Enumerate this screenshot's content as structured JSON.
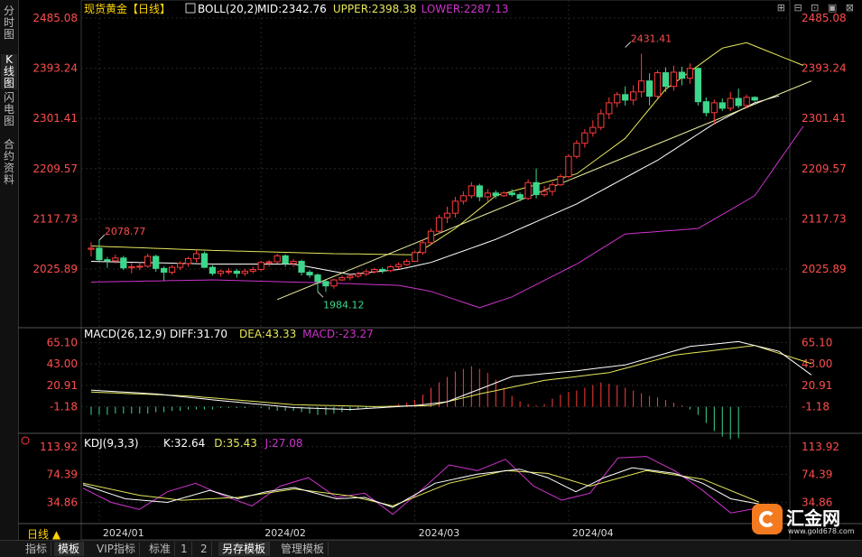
{
  "side_tabs": [
    "分时图",
    "K线图",
    "闪电图",
    "合约资料"
  ],
  "side_tab_active": 1,
  "toolbar_glyphs": "⊞ ⊟ ⊡ ▣ ⊠",
  "period_label": "日线 ▲",
  "bottom_tabs": [
    "指标",
    "模板",
    "VIP指标",
    "标准",
    "1",
    "2",
    "另存模板",
    "管理模板"
  ],
  "bottom_tab_active": [
    1,
    6
  ],
  "watermark": {
    "text": "汇金网",
    "url": "www.gold678.com"
  },
  "colors": {
    "up": "#ff3b3b",
    "down": "#3dd68c",
    "mid": "#ffffff",
    "upper": "#e6e65c",
    "lower": "#cc33cc",
    "trend": "#f0f0a0",
    "axis_red": "#ff4d4d",
    "macd_diff": "#ffffff",
    "macd_dea": "#e6e65c",
    "kdj_k": "#ffffff",
    "kdj_d": "#e6e65c",
    "kdj_j": "#cc33cc"
  },
  "chart_data": [
    {
      "type": "candlestick",
      "title": "现货黄金【日线】",
      "indicator": "BOLL(20,2)",
      "legend": [
        {
          "label": "MID:2342.76",
          "color": "mid"
        },
        {
          "label": "UPPER:2398.38",
          "color": "upper"
        },
        {
          "label": "LOWER:2287.13",
          "color": "lower"
        }
      ],
      "y_ticks": [
        "2485.08",
        "2393.24",
        "2301.41",
        "2209.57",
        "2117.73",
        "2025.89"
      ],
      "ylim": [
        1940,
        2485.08
      ],
      "x_ticks": [
        "2024/01",
        "2024/02",
        "2024/03",
        "2024/04"
      ],
      "x_tick_index": [
        1,
        21,
        40,
        59
      ],
      "annotations": [
        {
          "text": "2078.77",
          "index": 1,
          "value": 2078.77,
          "color": "#ff4d4d"
        },
        {
          "text": "1984.12",
          "index": 28,
          "value": 1984.12,
          "color": "#3dd68c"
        },
        {
          "text": "2431.41",
          "index": 66,
          "value": 2431.41,
          "color": "#ff4d4d"
        }
      ],
      "candles": [
        [
          2062,
          2064,
          2049,
          2075
        ],
        [
          2064,
          2043,
          2040,
          2079
        ],
        [
          2043,
          2041,
          2028,
          2048
        ],
        [
          2041,
          2046,
          2036,
          2052
        ],
        [
          2046,
          2028,
          2024,
          2050
        ],
        [
          2028,
          2030,
          2018,
          2037
        ],
        [
          2030,
          2031,
          2024,
          2038
        ],
        [
          2031,
          2049,
          2028,
          2054
        ],
        [
          2049,
          2027,
          2021,
          2052
        ],
        [
          2027,
          2020,
          2005,
          2031
        ],
        [
          2020,
          2029,
          2016,
          2033
        ],
        [
          2029,
          2036,
          2024,
          2040
        ],
        [
          2036,
          2045,
          2030,
          2048
        ],
        [
          2045,
          2054,
          2038,
          2060
        ],
        [
          2054,
          2029,
          2028,
          2058
        ],
        [
          2029,
          2018,
          2014,
          2033
        ],
        [
          2018,
          2022,
          2012,
          2025
        ],
        [
          2022,
          2022,
          2016,
          2028
        ],
        [
          2022,
          2018,
          2010,
          2026
        ],
        [
          2018,
          2022,
          2013,
          2026
        ],
        [
          2022,
          2025,
          2018,
          2030
        ],
        [
          2025,
          2038,
          2022,
          2041
        ],
        [
          2038,
          2039,
          2030,
          2042
        ],
        [
          2039,
          2050,
          2036,
          2054
        ],
        [
          2050,
          2036,
          2030,
          2053
        ],
        [
          2036,
          2040,
          2030,
          2044
        ],
        [
          2040,
          2020,
          2014,
          2043
        ],
        [
          2020,
          2015,
          2010,
          2024
        ],
        [
          2015,
          2003,
          1984,
          2018
        ],
        [
          2003,
          1995,
          1984,
          2006
        ],
        [
          1995,
          2006,
          1990,
          2008
        ],
        [
          2006,
          2010,
          2004,
          2014
        ],
        [
          2010,
          2013,
          2005,
          2016
        ],
        [
          2013,
          2017,
          2010,
          2021
        ],
        [
          2017,
          2021,
          2013,
          2025
        ],
        [
          2021,
          2025,
          2018,
          2028
        ],
        [
          2025,
          2023,
          2018,
          2029
        ],
        [
          2023,
          2030,
          2020,
          2033
        ],
        [
          2030,
          2034,
          2025,
          2038
        ],
        [
          2034,
          2040,
          2032,
          2044
        ],
        [
          2040,
          2056,
          2040,
          2060
        ],
        [
          2056,
          2074,
          2052,
          2080
        ],
        [
          2074,
          2095,
          2070,
          2100
        ],
        [
          2095,
          2120,
          2090,
          2125
        ],
        [
          2120,
          2128,
          2110,
          2140
        ],
        [
          2128,
          2150,
          2120,
          2158
        ],
        [
          2150,
          2160,
          2144,
          2168
        ],
        [
          2160,
          2178,
          2155,
          2185
        ],
        [
          2178,
          2158,
          2150,
          2182
        ],
        [
          2158,
          2165,
          2150,
          2172
        ],
        [
          2165,
          2160,
          2155,
          2170
        ],
        [
          2160,
          2165,
          2158,
          2168
        ],
        [
          2165,
          2162,
          2158,
          2172
        ],
        [
          2162,
          2155,
          2150,
          2166
        ],
        [
          2155,
          2184,
          2152,
          2190
        ],
        [
          2184,
          2162,
          2155,
          2210
        ],
        [
          2162,
          2168,
          2158,
          2178
        ],
        [
          2168,
          2180,
          2160,
          2185
        ],
        [
          2180,
          2195,
          2178,
          2200
        ],
        [
          2195,
          2232,
          2192,
          2236
        ],
        [
          2232,
          2256,
          2228,
          2262
        ],
        [
          2256,
          2275,
          2248,
          2282
        ],
        [
          2275,
          2285,
          2268,
          2298
        ],
        [
          2285,
          2310,
          2280,
          2318
        ],
        [
          2310,
          2330,
          2300,
          2340
        ],
        [
          2330,
          2345,
          2322,
          2350
        ],
        [
          2345,
          2335,
          2325,
          2360
        ],
        [
          2335,
          2350,
          2326,
          2362
        ],
        [
          2350,
          2370,
          2340,
          2420
        ],
        [
          2370,
          2342,
          2325,
          2384
        ],
        [
          2342,
          2385,
          2338,
          2390
        ],
        [
          2385,
          2360,
          2350,
          2395
        ],
        [
          2360,
          2386,
          2352,
          2398
        ],
        [
          2386,
          2375,
          2362,
          2396
        ],
        [
          2375,
          2393,
          2365,
          2402
        ],
        [
          2393,
          2332,
          2325,
          2395
        ],
        [
          2332,
          2312,
          2305,
          2340
        ],
        [
          2312,
          2330,
          2290,
          2336
        ],
        [
          2330,
          2320,
          2315,
          2338
        ],
        [
          2320,
          2338,
          2315,
          2350
        ],
        [
          2338,
          2325,
          2320,
          2356
        ],
        [
          2325,
          2340,
          2320,
          2345
        ],
        [
          2340,
          2335,
          2332,
          2342
        ]
      ],
      "boll_mid": [
        [
          0,
          2040
        ],
        [
          15,
          2035
        ],
        [
          25,
          2035
        ],
        [
          32,
          2016
        ],
        [
          38,
          2025
        ],
        [
          42,
          2038
        ],
        [
          50,
          2080
        ],
        [
          60,
          2145
        ],
        [
          70,
          2225
        ],
        [
          77,
          2292
        ],
        [
          82,
          2330
        ],
        [
          85,
          2342.76
        ]
      ],
      "boll_upper": [
        [
          0,
          2068
        ],
        [
          15,
          2060
        ],
        [
          30,
          2054
        ],
        [
          40,
          2052
        ],
        [
          45,
          2100
        ],
        [
          50,
          2160
        ],
        [
          60,
          2200
        ],
        [
          66,
          2265
        ],
        [
          71,
          2355
        ],
        [
          78,
          2430
        ],
        [
          81,
          2440
        ],
        [
          88,
          2398.38
        ]
      ],
      "boll_lower": [
        [
          0,
          2002
        ],
        [
          15,
          2006
        ],
        [
          30,
          2000
        ],
        [
          38,
          1996
        ],
        [
          42,
          1985
        ],
        [
          48,
          1955
        ],
        [
          52,
          1975
        ],
        [
          60,
          2035
        ],
        [
          66,
          2090
        ],
        [
          75,
          2100
        ],
        [
          82,
          2160
        ],
        [
          88,
          2287.13
        ]
      ],
      "trend_line": [
        [
          23,
          1970
        ],
        [
          89,
          2370
        ]
      ]
    },
    {
      "type": "macd",
      "indicator": "MACD(26,12,9)",
      "legend": [
        {
          "label": "DIFF:31.70",
          "color": "macd_diff"
        },
        {
          "label": "DEA:43.33",
          "color": "macd_dea"
        },
        {
          "label": "MACD:-23.27",
          "color": "kdj_j"
        }
      ],
      "y_ticks": [
        "65.10",
        "43.00",
        "20.91",
        "-1.18"
      ],
      "ylim": [
        -23,
        72
      ],
      "diff": [
        [
          0,
          16
        ],
        [
          8,
          12
        ],
        [
          15,
          6
        ],
        [
          25,
          -2
        ],
        [
          32,
          -4
        ],
        [
          40,
          0
        ],
        [
          44,
          4
        ],
        [
          52,
          30
        ],
        [
          60,
          36
        ],
        [
          66,
          42
        ],
        [
          74,
          61
        ],
        [
          80,
          66
        ],
        [
          85,
          56
        ],
        [
          89,
          31.7
        ]
      ],
      "dea": [
        [
          0,
          14
        ],
        [
          12,
          10
        ],
        [
          25,
          1
        ],
        [
          35,
          -1
        ],
        [
          42,
          0
        ],
        [
          48,
          12
        ],
        [
          56,
          26
        ],
        [
          64,
          34
        ],
        [
          72,
          52
        ],
        [
          82,
          62
        ],
        [
          89,
          43.33
        ]
      ],
      "histogram": [
        -6,
        -6,
        -6,
        -5,
        -5,
        -5,
        -5,
        -5,
        -4,
        -4,
        -3,
        -3,
        -2,
        -2,
        -2,
        -2,
        -1,
        -1,
        -1,
        -1,
        0,
        -1,
        -2,
        -3,
        -3,
        -3,
        -4,
        -5,
        -6,
        -6,
        -5,
        -4,
        -3,
        -2,
        -1,
        -1,
        0,
        1,
        2,
        3,
        5,
        9,
        14,
        18,
        22,
        26,
        28,
        30,
        28,
        25,
        20,
        14,
        8,
        4,
        2,
        1,
        2,
        6,
        9,
        11,
        12,
        14,
        16,
        18,
        17,
        16,
        14,
        12,
        10,
        8,
        7,
        5,
        3,
        1,
        -2,
        -6,
        -12,
        -18,
        -22,
        -24,
        -23.27
      ]
    },
    {
      "type": "kdj",
      "indicator": "KDJ(9,3,3)",
      "legend": [
        {
          "label": "K:32.64",
          "color": "kdj_k"
        },
        {
          "label": "D:35.43",
          "color": "kdj_d"
        },
        {
          "label": "J:27.08",
          "color": "kdj_j"
        }
      ],
      "y_ticks": [
        "113.92",
        "74.39",
        "34.86"
      ],
      "ylim": [
        10,
        120
      ],
      "k": [
        [
          0,
          60
        ],
        [
          6,
          40
        ],
        [
          12,
          35
        ],
        [
          18,
          52
        ],
        [
          22,
          40
        ],
        [
          26,
          50
        ],
        [
          30,
          56
        ],
        [
          36,
          40
        ],
        [
          40,
          42
        ],
        [
          44,
          28
        ],
        [
          50,
          62
        ],
        [
          56,
          75
        ],
        [
          62,
          82
        ],
        [
          66,
          70
        ],
        [
          70,
          50
        ],
        [
          74,
          70
        ],
        [
          78,
          84
        ],
        [
          84,
          76
        ],
        [
          88,
          62
        ],
        [
          92,
          40
        ],
        [
          96,
          32.64
        ]
      ],
      "d": [
        [
          0,
          62
        ],
        [
          8,
          45
        ],
        [
          14,
          38
        ],
        [
          22,
          42
        ],
        [
          30,
          54
        ],
        [
          38,
          44
        ],
        [
          44,
          30
        ],
        [
          52,
          62
        ],
        [
          60,
          80
        ],
        [
          66,
          76
        ],
        [
          72,
          58
        ],
        [
          80,
          80
        ],
        [
          88,
          68
        ],
        [
          96,
          35.43
        ]
      ],
      "j": [
        [
          0,
          55
        ],
        [
          4,
          35
        ],
        [
          8,
          25
        ],
        [
          12,
          50
        ],
        [
          16,
          62
        ],
        [
          20,
          44
        ],
        [
          24,
          30
        ],
        [
          28,
          58
        ],
        [
          32,
          70
        ],
        [
          36,
          42
        ],
        [
          40,
          48
        ],
        [
          44,
          18
        ],
        [
          48,
          52
        ],
        [
          52,
          88
        ],
        [
          56,
          80
        ],
        [
          60,
          96
        ],
        [
          64,
          58
        ],
        [
          68,
          38
        ],
        [
          72,
          48
        ],
        [
          76,
          98
        ],
        [
          80,
          100
        ],
        [
          84,
          80
        ],
        [
          88,
          52
        ],
        [
          92,
          20
        ],
        [
          96,
          27.08
        ]
      ]
    }
  ]
}
